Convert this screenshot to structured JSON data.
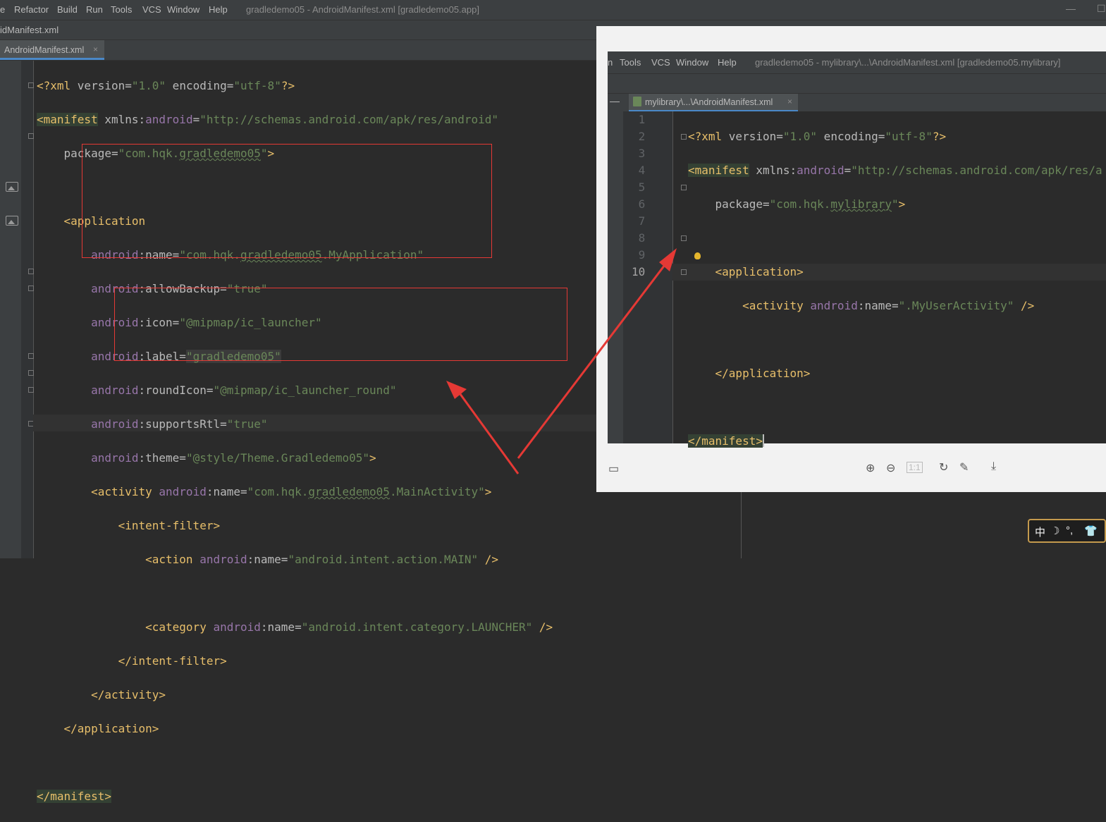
{
  "main": {
    "menu": [
      "e",
      "Refactor",
      "Build",
      "Run",
      "Tools",
      "VCS",
      "Window",
      "Help"
    ],
    "window_title": "gradledemo05 - AndroidManifest.xml [gradledemo05.app]",
    "breadcrumb": "idManifest.xml",
    "tab": {
      "label": "AndroidManifest.xml",
      "close": "×"
    },
    "code": {
      "l1_pi_open": "<?xml ",
      "l1_version_attr": "version",
      "l1_eq": "=",
      "l1_version_val": "\"1.0\"",
      "l1_encoding_attr": " encoding",
      "l1_encoding_val": "\"utf-8\"",
      "l1_pi_close": "?>",
      "l2_tag": "<manifest",
      "l2_attr": " xmlns:",
      "l2_ns": "android",
      "l2_val": "\"http://schemas.android.com/apk/res/android\"",
      "l3_attr": "package",
      "l3_val_pre": "\"com.hqk.",
      "l3_val_sq": "gradledemo05",
      "l3_val_post": "\"",
      "l3_close": ">",
      "l5_tag": "<application",
      "l6_ns": "android",
      "l6_attr": ":name",
      "l6_val_pre": "\"com.hqk.",
      "l6_val_sq": "gradledemo05",
      "l6_val_post": ".MyApplication\"",
      "l7_ns": "android",
      "l7_attr": ":allowBackup",
      "l7_val": "\"true\"",
      "l8_ns": "android",
      "l8_attr": ":icon",
      "l8_val": "\"@mipmap/ic_launcher\"",
      "l9_ns": "android",
      "l9_attr": ":label",
      "l9_val": "\"gradledemo05\"",
      "l10_ns": "android",
      "l10_attr": ":roundIcon",
      "l10_val": "\"@mipmap/ic_launcher_round\"",
      "l11_ns": "android",
      "l11_attr": ":supportsRtl",
      "l11_val": "\"true\"",
      "l12_ns": "android",
      "l12_attr": ":theme",
      "l12_val": "\"@style/Theme.Gradledemo05\"",
      "l12_close": ">",
      "l13_tag": "<activity",
      "l13_ns": " android",
      "l13_attr": ":name",
      "l13_val_pre": "\"com.hqk.",
      "l13_val_sq": "gradledemo05",
      "l13_val_post": ".MainActivity\"",
      "l13_close": ">",
      "l14_tag": "<intent-filter>",
      "l15_tag": "<action",
      "l15_ns": " android",
      "l15_attr": ":name",
      "l15_val": "\"android.intent.action.MAIN\"",
      "l15_close": " />",
      "l17_tag": "<category",
      "l17_ns": " android",
      "l17_attr": ":name",
      "l17_val": "\"android.intent.category.LAUNCHER\"",
      "l17_close": " />",
      "l18_tag": "</intent-filter>",
      "l19_tag": "</activity>",
      "l20_tag": "</application>",
      "l22_tag": "</manifest>"
    }
  },
  "overlay": {
    "menu": [
      "n",
      "Tools",
      "VCS",
      "Window",
      "Help"
    ],
    "window_title": "gradledemo05 - mylibrary\\...\\AndroidManifest.xml [gradledemo05.mylibrary]",
    "tab": {
      "label": "mylibrary\\...\\AndroidManifest.xml",
      "close": "×"
    },
    "line_numbers": [
      "1",
      "2",
      "3",
      "4",
      "5",
      "6",
      "7",
      "8",
      "9",
      "10"
    ],
    "code": {
      "l1_pi_open": "<?xml ",
      "l1_version_attr": "version",
      "l1_eq": "=",
      "l1_version_val": "\"1.0\"",
      "l1_encoding_attr": " encoding",
      "l1_encoding_val": "\"utf-8\"",
      "l1_pi_close": "?>",
      "l2_tag": "<manifest",
      "l2_attr": " xmlns:",
      "l2_ns": "android",
      "l2_val": "\"http://schemas.android.com/apk/res/a",
      "l3_attr": "package",
      "l3_val_pre": "\"com.hqk.",
      "l3_val_sq": "mylibrary",
      "l3_val_post": "\"",
      "l3_close": ">",
      "l5_tag": "<application>",
      "l6_tag": "<activity",
      "l6_ns": " android",
      "l6_attr": ":name",
      "l6_val": "\".MyUserActivity\"",
      "l6_close": " />",
      "l8_tag": "</application>",
      "l10_tag": "</manifest>"
    }
  },
  "ime": {
    "lang": "中",
    "moon": "☽",
    "punct": "°,",
    "shirt": "👕"
  },
  "colors": {
    "annotation_red": "#e53935",
    "tab_underline": "#4a88c7",
    "tag": "#e8bf6a",
    "value": "#6a8759",
    "namespace": "#9876aa"
  }
}
